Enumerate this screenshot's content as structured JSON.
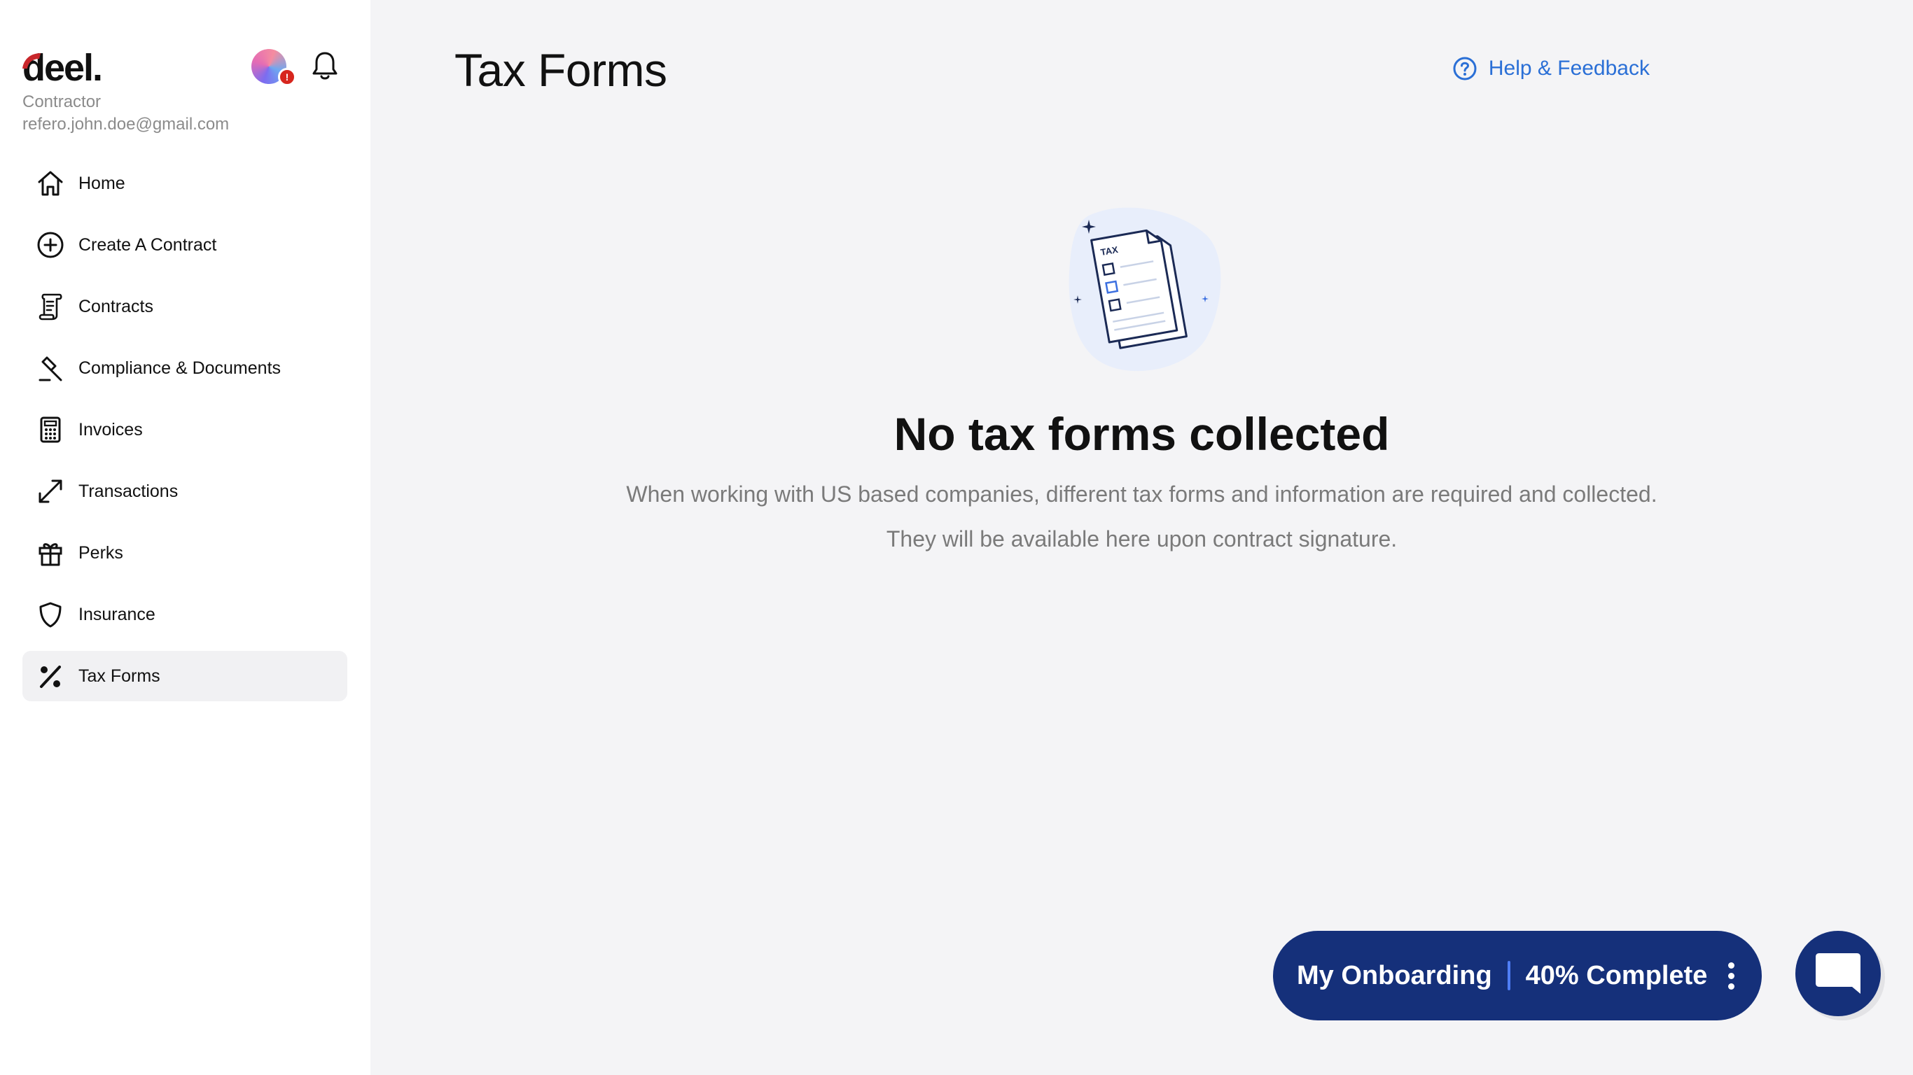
{
  "brand": {
    "logo_text": "deel."
  },
  "user": {
    "role": "Contractor",
    "email": "refero.john.doe@gmail.com",
    "badge": "!"
  },
  "sidebar": {
    "items": [
      {
        "label": "Home",
        "icon": "home-icon"
      },
      {
        "label": "Create A Contract",
        "icon": "plus-circle-icon"
      },
      {
        "label": "Contracts",
        "icon": "scroll-icon"
      },
      {
        "label": "Compliance & Documents",
        "icon": "gavel-icon"
      },
      {
        "label": "Invoices",
        "icon": "calculator-icon"
      },
      {
        "label": "Transactions",
        "icon": "arrows-diagonal-icon"
      },
      {
        "label": "Perks",
        "icon": "gift-icon"
      },
      {
        "label": "Insurance",
        "icon": "shield-icon"
      },
      {
        "label": "Tax Forms",
        "icon": "percent-icon",
        "active": true
      }
    ]
  },
  "main": {
    "title": "Tax Forms",
    "help_label": "Help & Feedback",
    "empty_state": {
      "illustration_label": "TAX",
      "title": "No tax forms collected",
      "desc_line1": "When working with US based companies, different tax forms and information are required and collected.",
      "desc_line2": "They will be available here upon contract signature."
    }
  },
  "onboarding": {
    "label": "My Onboarding",
    "progress_text": "40% Complete",
    "progress": 0.4
  },
  "colors": {
    "accent": "#2a6fd6",
    "navy": "#15307a",
    "badge_red": "#d7261e",
    "logo_red": "#c8262b"
  }
}
